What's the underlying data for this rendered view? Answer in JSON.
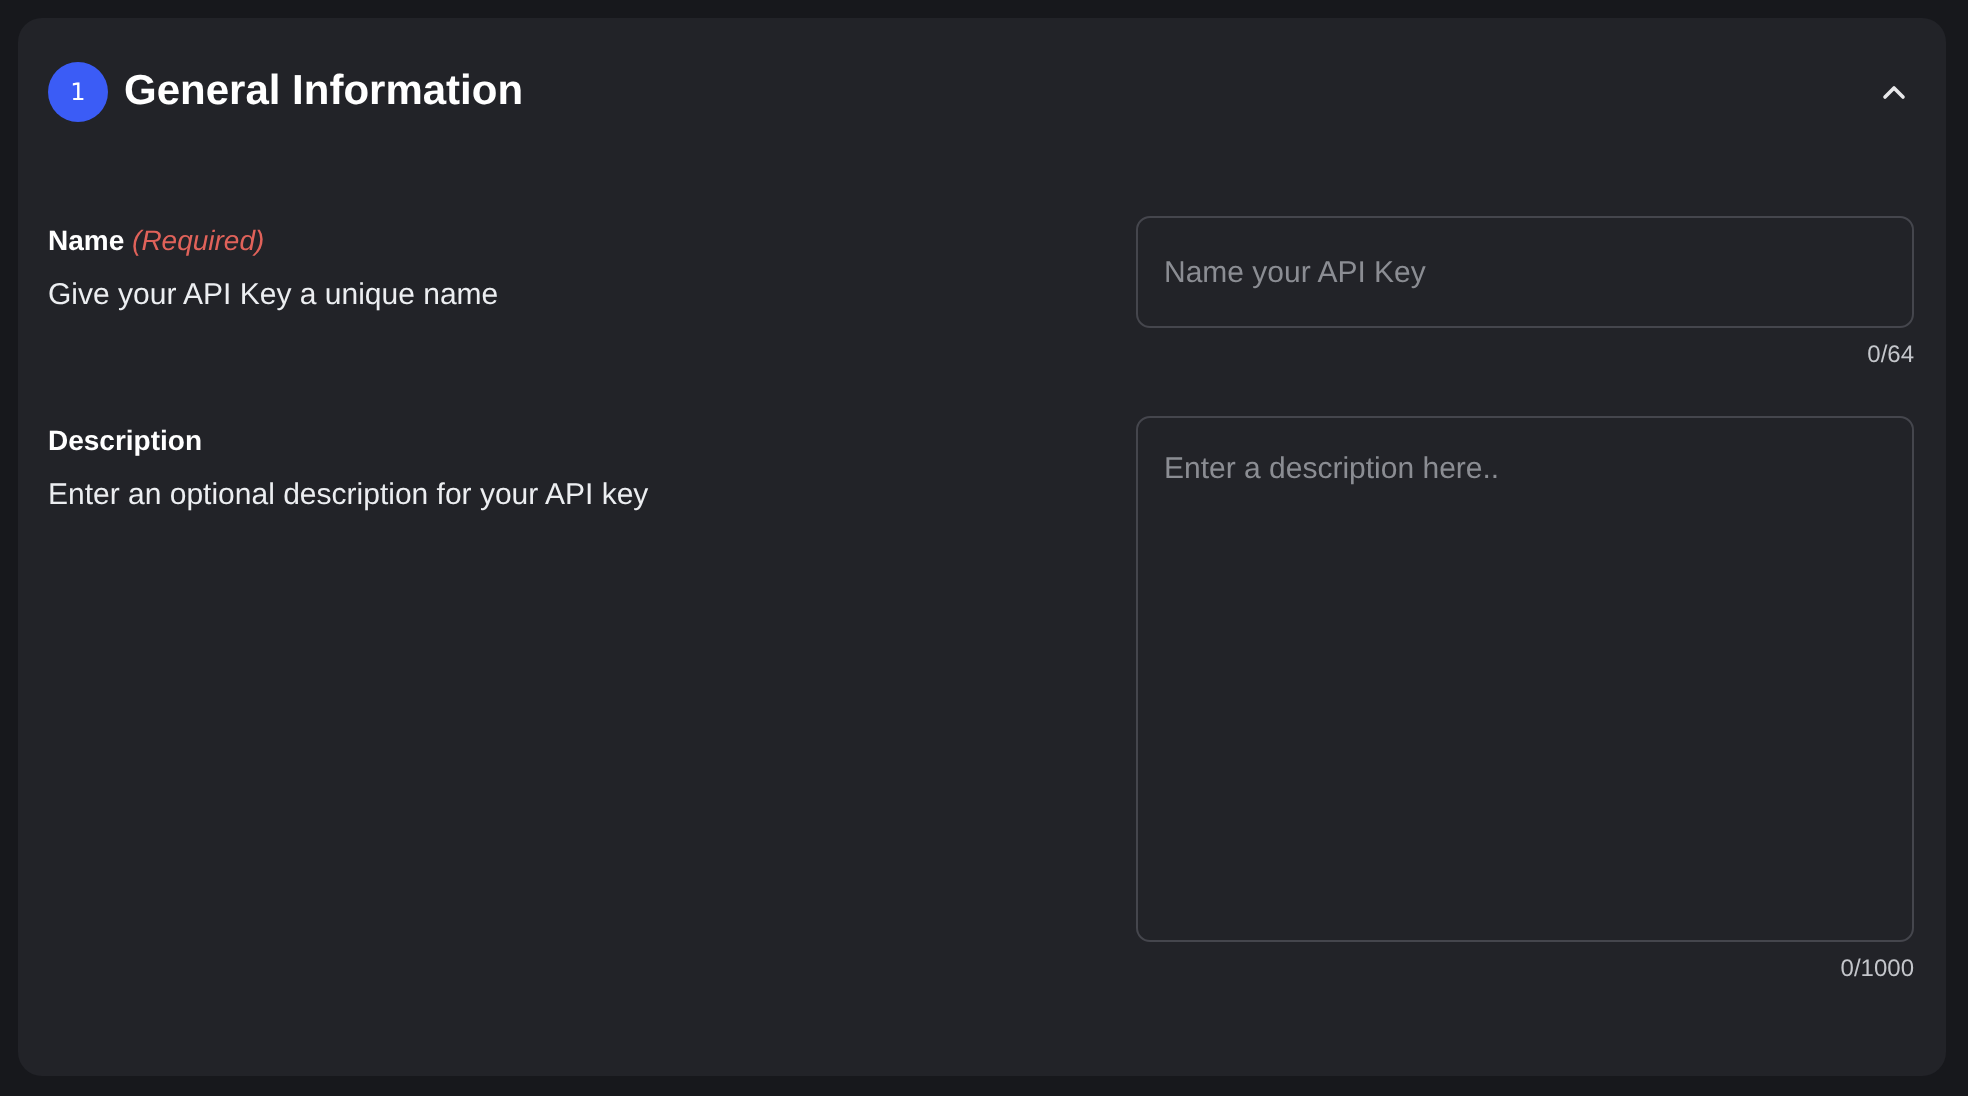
{
  "section": {
    "number": "1",
    "title": "General Information",
    "expanded": true
  },
  "fields": [
    {
      "kind": "input",
      "label": "Name",
      "required_note": "(Required)",
      "description": "Give your API Key a unique name",
      "placeholder": "Name your API Key",
      "counter": "0/64"
    },
    {
      "kind": "textarea",
      "label": "Description",
      "description": "Enter an optional description for your API key",
      "placeholder": "Enter a description here..",
      "counter": "0/1000"
    }
  ]
}
